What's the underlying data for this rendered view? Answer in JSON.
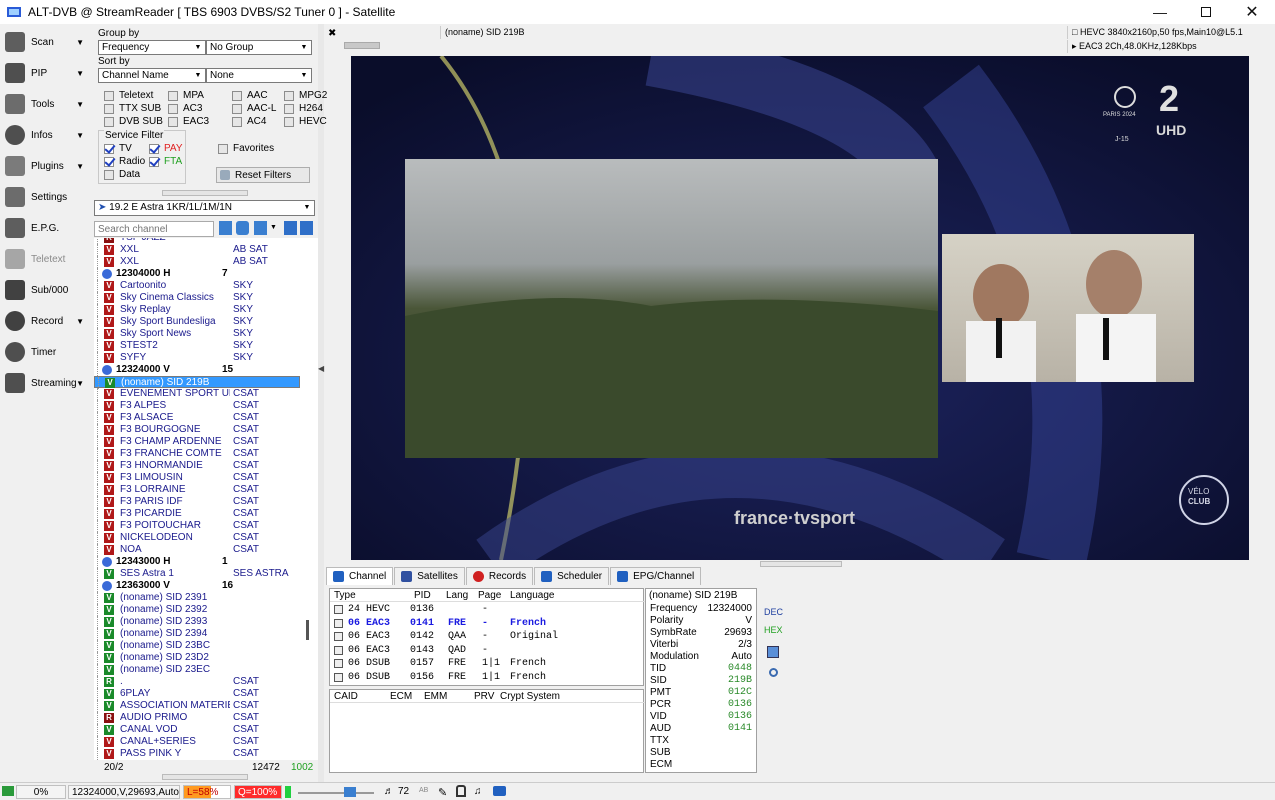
{
  "window": {
    "title": "ALT-DVB @ StreamReader [ TBS 6903 DVBS/S2 Tuner 0 ] - Satellite"
  },
  "sidebar": {
    "items": [
      {
        "label": "Scan",
        "icon": "satellite-dish-icon"
      },
      {
        "label": "PIP",
        "icon": "pip-icon"
      },
      {
        "label": "Tools",
        "icon": "tools-icon"
      },
      {
        "label": "Infos",
        "icon": "info-icon"
      },
      {
        "label": "Plugins",
        "icon": "plugins-icon"
      },
      {
        "label": "Settings",
        "icon": "gear-icon"
      },
      {
        "label": "E.P.G.",
        "icon": "epg-icon"
      },
      {
        "label": "Teletext",
        "icon": "teletext-icon"
      },
      {
        "label": "Sub/000",
        "icon": "subtitle-icon"
      },
      {
        "label": "Record",
        "icon": "record-icon"
      },
      {
        "label": "Timer",
        "icon": "timer-icon"
      },
      {
        "label": "Streaming",
        "icon": "streaming-icon"
      }
    ]
  },
  "filters": {
    "group_by_label": "Group by",
    "group_by_value": "Frequency",
    "group_by_value2": "No Group",
    "sort_by_label": "Sort by",
    "sort_by_value": "Channel Name",
    "sort_by_value2": "None",
    "checks": [
      "Teletext",
      "MPA",
      "AAC",
      "MPG2",
      "TTX SUB",
      "AC3",
      "AAC-L",
      "H264",
      "DVB SUB",
      "EAC3",
      "AC4",
      "HEVC"
    ],
    "service_filter_label": "Service Filter",
    "tv": "TV",
    "pay": "PAY",
    "radio": "Radio",
    "fta": "FTA",
    "data": "Data",
    "favorites": "Favorites",
    "reset": "Reset Filters",
    "colors": {
      "pay": "#e02020",
      "fta": "#20a020"
    }
  },
  "satellite": {
    "selected": "19.2 E Astra 1KR/1L/1M/1N"
  },
  "search": {
    "placeholder": "Search channel"
  },
  "channels": [
    {
      "kind": "ch",
      "badge": "R",
      "name": "TSF JAZZ",
      "provider": ""
    },
    {
      "kind": "ch",
      "badge": "V",
      "name": "XXL",
      "provider": "AB SAT"
    },
    {
      "kind": "ch",
      "badge": "V",
      "name": "XXL",
      "provider": "AB SAT"
    },
    {
      "kind": "tp",
      "name": "12304000 H",
      "provider": "7"
    },
    {
      "kind": "ch",
      "badge": "V",
      "name": "Cartoonito",
      "provider": "SKY"
    },
    {
      "kind": "ch",
      "badge": "V",
      "name": "Sky Cinema Classics",
      "provider": "SKY"
    },
    {
      "kind": "ch",
      "badge": "V",
      "name": "Sky Replay",
      "provider": "SKY"
    },
    {
      "kind": "ch",
      "badge": "V",
      "name": "Sky Sport Bundesliga",
      "provider": "SKY"
    },
    {
      "kind": "ch",
      "badge": "V",
      "name": "Sky Sport News",
      "provider": "SKY"
    },
    {
      "kind": "ch",
      "badge": "V",
      "name": "STEST2",
      "provider": "SKY"
    },
    {
      "kind": "ch",
      "badge": "V",
      "name": "SYFY",
      "provider": "SKY"
    },
    {
      "kind": "tp",
      "name": "12324000 V",
      "provider": "15"
    },
    {
      "kind": "sel",
      "badge": "V",
      "name": "(noname) SID 219B",
      "provider": ""
    },
    {
      "kind": "ch",
      "badge": "V",
      "name": "EVENEMENT SPORT UH...",
      "provider": "CSAT"
    },
    {
      "kind": "ch",
      "badge": "V",
      "name": "F3 ALPES",
      "provider": "CSAT"
    },
    {
      "kind": "ch",
      "badge": "V",
      "name": "F3 ALSACE",
      "provider": "CSAT"
    },
    {
      "kind": "ch",
      "badge": "V",
      "name": "F3 BOURGOGNE",
      "provider": "CSAT"
    },
    {
      "kind": "ch",
      "badge": "V",
      "name": "F3 CHAMP ARDENNE",
      "provider": "CSAT"
    },
    {
      "kind": "ch",
      "badge": "V",
      "name": "F3 FRANCHE COMTE",
      "provider": "CSAT"
    },
    {
      "kind": "ch",
      "badge": "V",
      "name": "F3 HNORMANDIE",
      "provider": "CSAT"
    },
    {
      "kind": "ch",
      "badge": "V",
      "name": "F3 LIMOUSIN",
      "provider": "CSAT"
    },
    {
      "kind": "ch",
      "badge": "V",
      "name": "F3 LORRAINE",
      "provider": "CSAT"
    },
    {
      "kind": "ch",
      "badge": "V",
      "name": "F3 PARIS IDF",
      "provider": "CSAT"
    },
    {
      "kind": "ch",
      "badge": "V",
      "name": "F3 PICARDIE",
      "provider": "CSAT"
    },
    {
      "kind": "ch",
      "badge": "V",
      "name": "F3 POITOUCHAR",
      "provider": "CSAT"
    },
    {
      "kind": "ch",
      "badge": "V",
      "name": "NICKELODEON",
      "provider": "CSAT"
    },
    {
      "kind": "ch",
      "badge": "V",
      "name": "NOA",
      "provider": "CSAT"
    },
    {
      "kind": "tp",
      "name": "12343000 H",
      "provider": "1"
    },
    {
      "kind": "fta",
      "badge": "V",
      "name": "SES Astra 1",
      "provider": "SES ASTRA"
    },
    {
      "kind": "tp",
      "name": "12363000 V",
      "provider": "16"
    },
    {
      "kind": "fta",
      "badge": "V",
      "name": "(noname) SID 2391",
      "provider": ""
    },
    {
      "kind": "fta",
      "badge": "V",
      "name": "(noname) SID 2392",
      "provider": ""
    },
    {
      "kind": "fta",
      "badge": "V",
      "name": "(noname) SID 2393",
      "provider": ""
    },
    {
      "kind": "fta",
      "badge": "V",
      "name": "(noname) SID 2394",
      "provider": ""
    },
    {
      "kind": "fta",
      "badge": "V",
      "name": "(noname) SID 23BC",
      "provider": ""
    },
    {
      "kind": "fta",
      "badge": "V",
      "name": "(noname) SID 23D2",
      "provider": ""
    },
    {
      "kind": "fta",
      "badge": "V",
      "name": "(noname) SID 23EC",
      "provider": ""
    },
    {
      "kind": "ftar",
      "badge": "R",
      "name": ".",
      "provider": "CSAT"
    },
    {
      "kind": "fta",
      "badge": "V",
      "name": "6PLAY",
      "provider": "CSAT"
    },
    {
      "kind": "fta",
      "badge": "V",
      "name": "ASSOCIATION MATERIEL",
      "provider": "CSAT"
    },
    {
      "kind": "ch",
      "badge": "R",
      "name": "AUDIO PRIMO",
      "provider": "CSAT"
    },
    {
      "kind": "fta",
      "badge": "V",
      "name": "CANAL VOD",
      "provider": "CSAT"
    },
    {
      "kind": "ch",
      "badge": "V",
      "name": "CANAL+SERIES",
      "provider": "CSAT"
    },
    {
      "kind": "ch",
      "badge": "V",
      "name": "PASS PINK Y",
      "provider": "CSAT"
    }
  ],
  "channel_footer": {
    "position": "20/2",
    "total": "12472",
    "count": "1002"
  },
  "video_header": {
    "channel": "(noname) SID 219B",
    "video_info": "HEVC 3840x2160p,50 fps,Main10@L5.1",
    "audio_info": "EAC3 2Ch,48.0KHz,128Kbps"
  },
  "video_overlay": {
    "olympics": "PARIS 2024",
    "day": "J-15",
    "ch_num": "2",
    "uhd": "UHD",
    "velo": "VÉLO",
    "club": "CLUB",
    "brand": "france·tvsport"
  },
  "bottom_tabs": [
    "Channel",
    "Satellites",
    "Records",
    "Scheduler",
    "EPG/Channel"
  ],
  "streams": {
    "headers": [
      "Type",
      "PID",
      "Lang",
      "Page",
      "Language"
    ],
    "rows": [
      {
        "type": "24 HEVC",
        "pid": "0136",
        "lang": "",
        "page": "-",
        "language": ""
      },
      {
        "type": "06 EAC3",
        "pid": "0141",
        "lang": "FRE",
        "page": "-",
        "language": "French",
        "active": true
      },
      {
        "type": "06 EAC3",
        "pid": "0142",
        "lang": "QAA",
        "page": "-",
        "language": "Original"
      },
      {
        "type": "06 EAC3",
        "pid": "0143",
        "lang": "QAD",
        "page": "-",
        "language": ""
      },
      {
        "type": "06 DSUB",
        "pid": "0157",
        "lang": "FRE",
        "page": "1|1",
        "language": "French"
      },
      {
        "type": "06 DSUB",
        "pid": "0156",
        "lang": "FRE",
        "page": "1|1",
        "language": "French"
      }
    ]
  },
  "crypt": {
    "headers": [
      "CAID",
      "ECM",
      "EMM",
      "PRV",
      "Crypt System"
    ]
  },
  "info_panel": {
    "title": "(noname) SID 219B",
    "rows": [
      {
        "k": "Frequency",
        "v": "12324000"
      },
      {
        "k": "Polarity",
        "v": "V"
      },
      {
        "k": "SymbRate",
        "v": "29693"
      },
      {
        "k": "Viterbi",
        "v": "2/3"
      },
      {
        "k": "Modulation",
        "v": "Auto"
      },
      {
        "k": "TID",
        "v": "0448",
        "hex": true
      },
      {
        "k": "SID",
        "v": "219B",
        "hex": true
      },
      {
        "k": "PMT",
        "v": "012C",
        "hex": true
      },
      {
        "k": "PCR",
        "v": "0136",
        "hex": true
      },
      {
        "k": "VID",
        "v": "0136",
        "hex": true
      },
      {
        "k": "AUD",
        "v": "0141",
        "hex": true
      },
      {
        "k": "TTX",
        "v": ""
      },
      {
        "k": "SUB",
        "v": ""
      },
      {
        "k": "ECM",
        "v": ""
      }
    ],
    "dec": "DEC",
    "hex_btn": "HEX"
  },
  "statusbar": {
    "percent": "0%",
    "tuning": "12324000,V,29693,Auto",
    "level": "L=58%",
    "quality": "Q=100%",
    "level_fraction": 0.58,
    "volume": "72",
    "ab": "AB"
  }
}
